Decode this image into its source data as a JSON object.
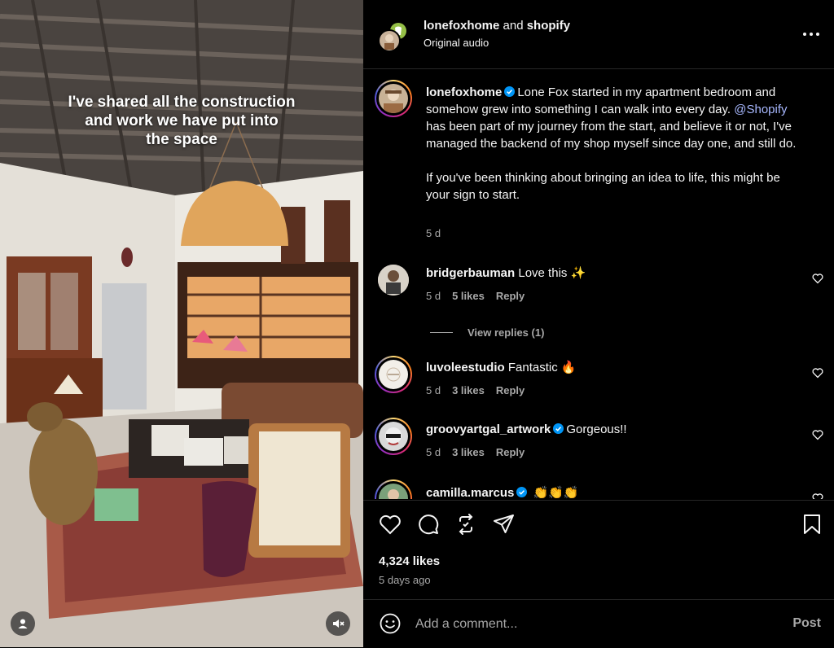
{
  "media": {
    "overlay_lines": [
      "I've shared all the construction",
      "and work we have put into",
      "the space"
    ]
  },
  "header": {
    "author": "lonefoxhome",
    "joiner": "and",
    "collaborator": "shopify",
    "audio": "Original audio",
    "more_icon": "more-horizontal-icon"
  },
  "caption": {
    "username": "lonefoxhome",
    "text_before": "Lone Fox started in my apartment bedroom and somehow grew into something I can walk into every day.",
    "mention": "@Shopify",
    "text_after": "has been part of my journey from the start, and believe it or not, I've managed the backend of my shop myself since day one, and still do.",
    "paragraph2": "If you've been thinking about bringing an idea to life, this might be your sign to start.",
    "age": "5 d"
  },
  "comments": [
    {
      "username": "bridgerbauman",
      "text": "Love this ✨",
      "age": "5 d",
      "likes": "5 likes",
      "reply": "Reply"
    },
    {
      "username": "luvoleestudio",
      "text": "Fantastic 🔥",
      "age": "5 d",
      "likes": "3 likes",
      "reply": "Reply"
    },
    {
      "username": "groovyartgal_artwork",
      "text": "Gorgeous!!",
      "age": "5 d",
      "likes": "3 likes",
      "reply": "Reply"
    },
    {
      "username": "camilla.marcus",
      "text": "👏👏👏"
    }
  ],
  "view_replies": "View replies (1)",
  "actions": {
    "likes": "4,324 likes",
    "posted": "5 days ago"
  },
  "add_comment": {
    "placeholder": "Add a comment...",
    "post_label": "Post"
  },
  "colors": {
    "background": "#000000",
    "text": "#f5f5f5",
    "muted": "#a8a8a8",
    "link": "#a8b8ff",
    "verified": "#0095f6"
  }
}
